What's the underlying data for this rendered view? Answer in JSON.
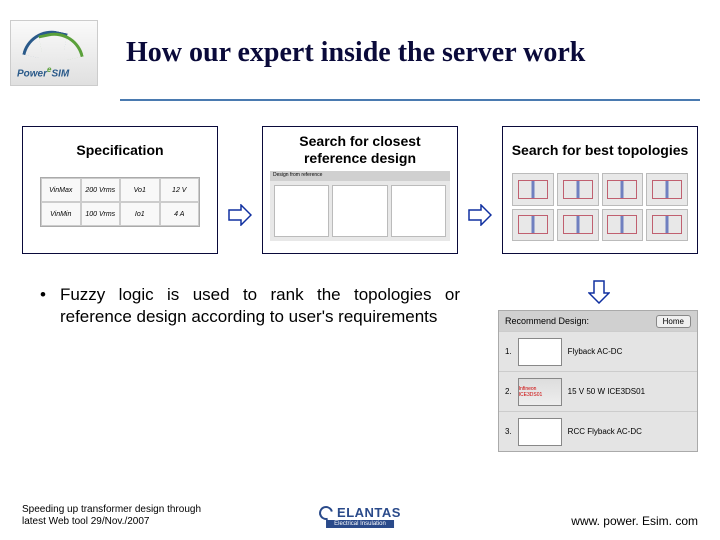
{
  "logo": {
    "brand": "Power",
    "suffix": "SIM",
    "e": "e"
  },
  "title": "How our expert inside the server work",
  "flow": [
    {
      "label": "Specification"
    },
    {
      "label": "Search for closest reference design"
    },
    {
      "label": "Search for best topologies"
    }
  ],
  "spec_table": {
    "r1": {
      "c1": "VinMax",
      "c2": "200  Vrms",
      "c3": "Vo1",
      "c4": "12  V"
    },
    "r2": {
      "c1": "VinMin",
      "c2": "100  Vrms",
      "c3": "Io1",
      "c4": "4   A"
    }
  },
  "ref_panel": {
    "header": "Design from reference"
  },
  "bullet": "Fuzzy logic is used to rank the topologies or reference design according to user's requirements",
  "recommend": {
    "title": "Recommend Design:",
    "home": "Home",
    "rows": [
      {
        "n": "1.",
        "caption": "Flyback AC-DC"
      },
      {
        "n": "2.",
        "caption": "15 V 50 W ICE3DS01",
        "chip": "Infineon ICE3DS01"
      },
      {
        "n": "3.",
        "caption": "RCC Flyback AC-DC"
      }
    ]
  },
  "footer": {
    "left_line1": "Speeding up transformer design through",
    "left_line2": "latest Web tool               29/Nov./2007",
    "center_name": "ELANTAS",
    "center_sub": "Electrical Insulation",
    "right": "www. power. Esim. com"
  }
}
